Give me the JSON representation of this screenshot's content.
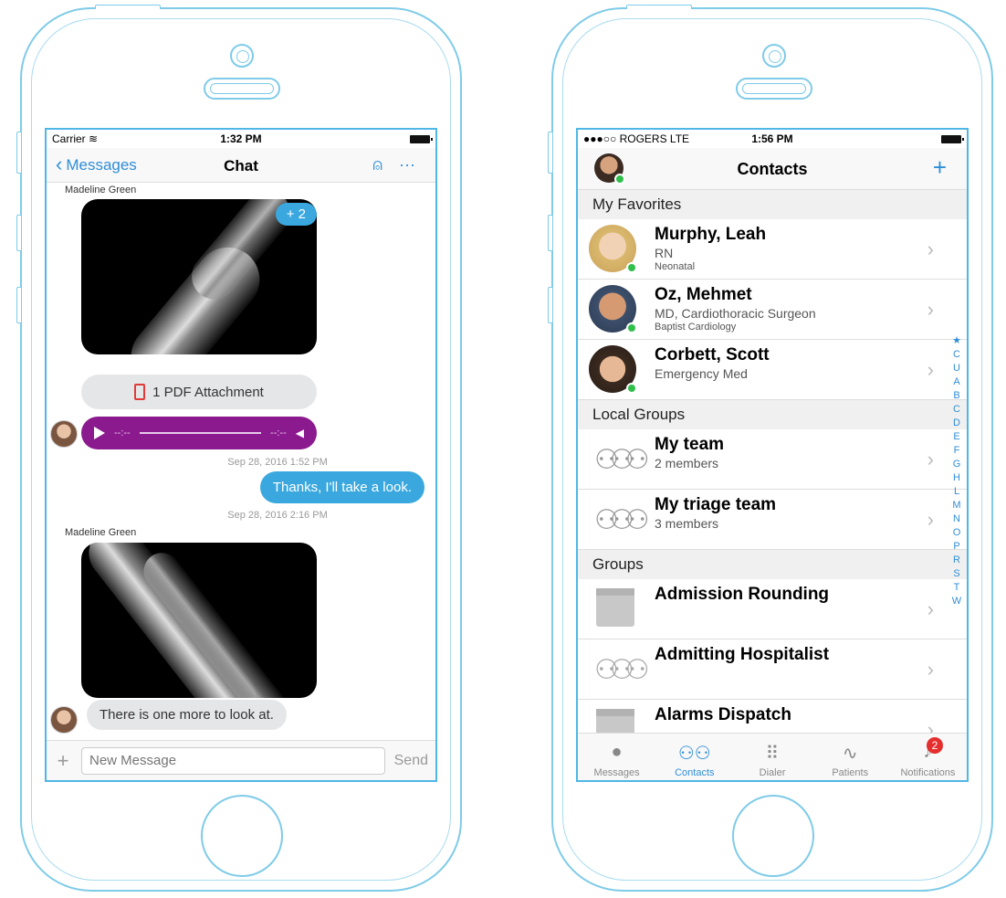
{
  "chat": {
    "status": {
      "carrier": "Carrier",
      "time": "1:32 PM"
    },
    "nav": {
      "back_label": "Messages",
      "title": "Chat"
    },
    "messages": {
      "sender_1": "Madeline Green",
      "more_images_badge": "+ 2",
      "pdf_label": "1 PDF Attachment",
      "audio_time_left": "--:--",
      "audio_time_right": "--:--",
      "timestamp_1": "Sep 28, 2016 1:52 PM",
      "outgoing_1": "Thanks, I'll take a look.",
      "timestamp_2": "Sep 28, 2016 2:16 PM",
      "sender_2": "Madeline Green",
      "incoming_1": "There is one more to look at."
    },
    "composer": {
      "placeholder": "New Message",
      "send_label": "Send"
    }
  },
  "contacts": {
    "status": {
      "carrier": "●●●○○ ROGERS  LTE",
      "time": "1:56 PM"
    },
    "nav": {
      "title": "Contacts",
      "add_label": "+"
    },
    "sections": {
      "favorites": "My Favorites",
      "local_groups": "Local Groups",
      "groups": "Groups"
    },
    "favorites": [
      {
        "name": "Murphy, Leah",
        "line1": "RN",
        "line2": "Neonatal"
      },
      {
        "name": "Oz, Mehmet",
        "line1": "MD, Cardiothoracic Surgeon",
        "line2": "Baptist Cardiology"
      },
      {
        "name": "Corbett, Scott",
        "line1": "Emergency Med",
        "line2": ""
      }
    ],
    "local_groups": [
      {
        "name": "My team",
        "members": "2 members"
      },
      {
        "name": "My triage team",
        "members": "3 members"
      }
    ],
    "groups": [
      {
        "name": "Admission Rounding"
      },
      {
        "name": "Admitting Hospitalist"
      },
      {
        "name": "Alarms Dispatch"
      }
    ],
    "index_letters": [
      "★",
      "C",
      "U",
      "A",
      "B",
      "C",
      "D",
      "E",
      "F",
      "G",
      "H",
      "L",
      "M",
      "N",
      "O",
      "P",
      "R",
      "S",
      "T",
      "W"
    ],
    "tabs": [
      {
        "label": "Messages",
        "icon": "chat-bubble-icon"
      },
      {
        "label": "Contacts",
        "icon": "people-icon"
      },
      {
        "label": "Dialer",
        "icon": "keypad-icon"
      },
      {
        "label": "Patients",
        "icon": "heartbeat-icon"
      },
      {
        "label": "Notifications",
        "icon": "bell-icon"
      }
    ],
    "notification_count": "2"
  },
  "colors": {
    "accent": "#2f8ed8",
    "bubble_out": "#3aa8de",
    "audio": "#8b1a8e",
    "online": "#2fbf4a",
    "badge": "#e52e2e"
  }
}
